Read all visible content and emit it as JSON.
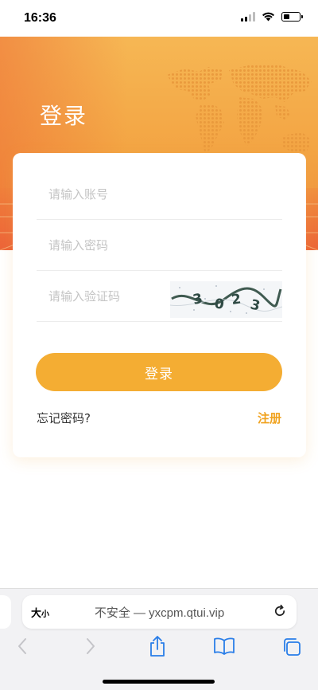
{
  "status_bar": {
    "time": "16:36"
  },
  "hero": {
    "title": "登录"
  },
  "form": {
    "account_placeholder": "请输入账号",
    "password_placeholder": "请输入密码",
    "captcha_placeholder": "请输入验证码",
    "captcha_code": [
      "3",
      "0",
      "2",
      "3"
    ],
    "login_label": "登录",
    "forgot_label": "忘记密码?",
    "register_label": "注册"
  },
  "browser": {
    "text_size_label": "大",
    "text_size_small": "小",
    "url": "不安全 — yxcpm.qtui.vip",
    "icons": [
      "back-icon",
      "forward-icon",
      "share-icon",
      "bookmarks-icon",
      "tabs-icon",
      "reload-icon"
    ]
  },
  "colors": {
    "accent": "#f4ad33",
    "register": "#f0a21e",
    "hero_top": "#f6b754",
    "hero_bottom": "#ee8a3c"
  }
}
